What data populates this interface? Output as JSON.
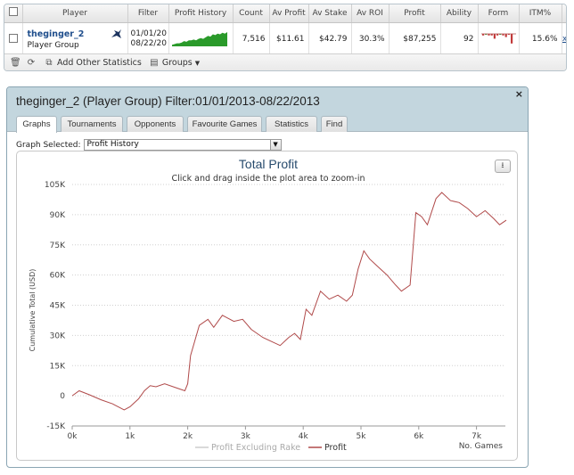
{
  "stats_table": {
    "columns": [
      "",
      "Player",
      "Filter",
      "Profit History",
      "Count",
      "Av Profit",
      "Av Stake",
      "Av ROI",
      "Profit",
      "Ability",
      "Form",
      "ITM%",
      ""
    ],
    "row": {
      "player_name": "theginger_2",
      "player_type": "Player Group",
      "filter_line1": "01/01/20",
      "filter_line2": "08/22/20",
      "count": "7,516",
      "av_profit": "$11.61",
      "av_stake": "$42.79",
      "av_roi": "30.3%",
      "profit": "$87,255",
      "ability": "92",
      "itm": "15.6%",
      "remove": "x"
    },
    "spark_values": [
      2,
      3,
      4,
      4,
      5,
      7,
      6,
      8,
      8,
      9,
      8,
      10,
      11,
      10,
      12,
      14,
      13,
      16,
      15,
      17,
      16,
      18,
      17,
      19
    ],
    "form_values": [
      1,
      0,
      1,
      1,
      3,
      1,
      0,
      1,
      2,
      0,
      6
    ],
    "colors": {
      "spark": "#2a9a2a",
      "form_neg": "#c23a3a",
      "form_pos": "#2a9a2a"
    }
  },
  "toolbar": {
    "delete_icon": "trash-icon",
    "refresh_icon": "refresh-icon",
    "add_stats_label": "Add Other Statistics",
    "groups_label": "Groups"
  },
  "window": {
    "title": "theginger_2 (Player Group) Filter:01/01/2013-08/22/2013",
    "close": "×",
    "tabs": [
      "Graphs",
      "Tournaments",
      "Opponents",
      "Favourite Games",
      "Statistics",
      "Find"
    ],
    "active_tab": "Graphs",
    "graph_selected_label": "Graph Selected:",
    "graph_selected_value": "Profit History"
  },
  "chart_data": {
    "type": "line",
    "title": "Total Profit",
    "subtitle": "Click and drag inside the plot area to zoom-in",
    "ylabel": "Cumulative Total (USD)",
    "xlabel": "No. Games",
    "xlim": [
      0,
      7516
    ],
    "ylim": [
      -15000,
      105000
    ],
    "x_ticks": [
      "0k",
      "1k",
      "2k",
      "3k",
      "4k",
      "5k",
      "6k",
      "7k"
    ],
    "y_ticks": [
      "-15K",
      "0",
      "15K",
      "30K",
      "45K",
      "60K",
      "75K",
      "90K",
      "105K"
    ],
    "legend": [
      "Profit Excluding Rake",
      "Profit"
    ],
    "legend_position": "bottom",
    "series": [
      {
        "name": "Profit",
        "color": "#b04a4a",
        "x": [
          0,
          120,
          300,
          500,
          700,
          900,
          1000,
          1150,
          1250,
          1350,
          1450,
          1600,
          1800,
          1950,
          2000,
          2050,
          2200,
          2350,
          2450,
          2600,
          2800,
          2950,
          3100,
          3300,
          3450,
          3600,
          3750,
          3850,
          3950,
          4050,
          4150,
          4300,
          4450,
          4600,
          4750,
          4850,
          4950,
          5050,
          5150,
          5300,
          5450,
          5600,
          5700,
          5850,
          5950,
          6050,
          6150,
          6300,
          6400,
          6550,
          6700,
          6850,
          7000,
          7150,
          7300,
          7400,
          7516
        ],
        "y": [
          0,
          2500,
          500,
          -2000,
          -4000,
          -7000,
          -5500,
          -1500,
          2500,
          5000,
          4500,
          6000,
          4000,
          2500,
          6000,
          20000,
          35000,
          38000,
          34000,
          40000,
          37000,
          38000,
          33000,
          29000,
          27000,
          25000,
          29000,
          31000,
          28000,
          43000,
          40000,
          52000,
          48000,
          50000,
          47000,
          50000,
          63000,
          72000,
          68000,
          64000,
          60000,
          55000,
          52000,
          55000,
          91000,
          89000,
          85000,
          98000,
          101000,
          97000,
          96000,
          93000,
          89000,
          92000,
          88000,
          85000,
          87255
        ]
      }
    ]
  }
}
